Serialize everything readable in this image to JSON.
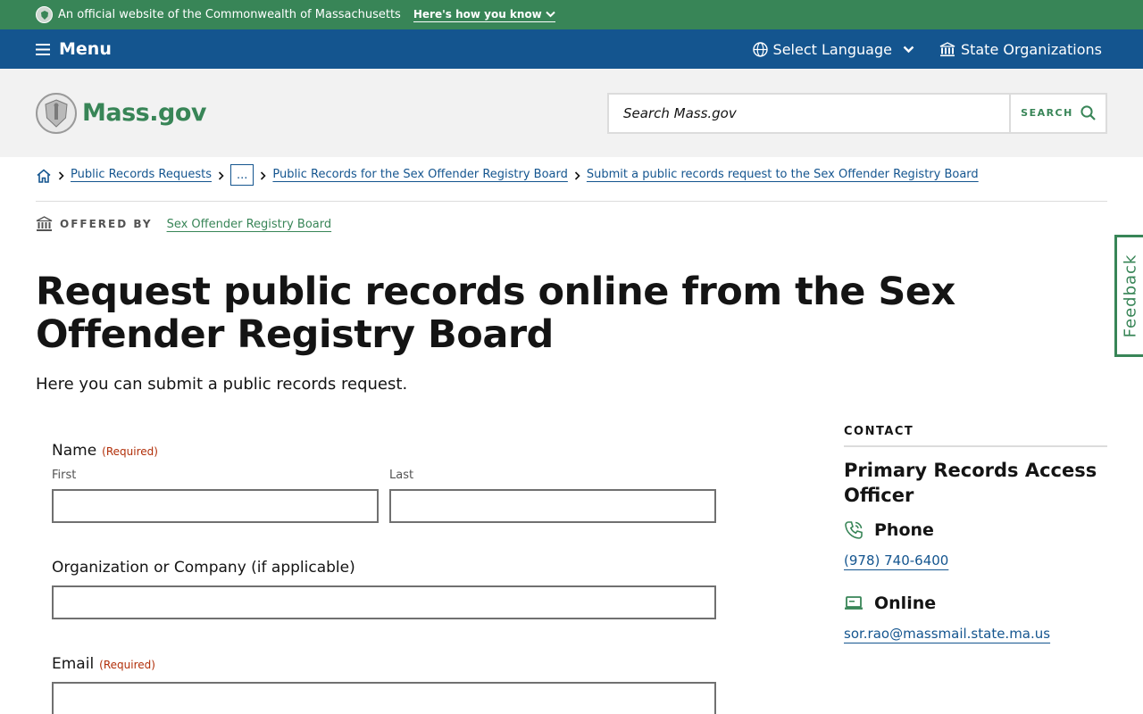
{
  "official_banner": {
    "text": "An official website of the Commonwealth of Massachusetts",
    "how_you_know": "Here's how you know"
  },
  "utility_nav": {
    "menu_label": "Menu",
    "language_label": "Select Language",
    "state_orgs_label": "State Organizations"
  },
  "header": {
    "logo_text": "Mass.gov",
    "search_placeholder": "Search Mass.gov",
    "search_button": "SEARCH"
  },
  "breadcrumb": {
    "items": [
      "Public Records Requests",
      "...",
      "Public Records for the Sex Offender Registry Board",
      "Submit a public records request to the Sex Offender Registry Board"
    ]
  },
  "offered_by": {
    "label": "OFFERED BY",
    "org": "Sex Offender Registry Board"
  },
  "page": {
    "title": "Request public records online from the Sex Offender Registry Board",
    "lede": "Here you can submit a public records request."
  },
  "feedback": {
    "label": "Feedback"
  },
  "form": {
    "name_label": "Name",
    "required_text": "(Required)",
    "first_label": "First",
    "last_label": "Last",
    "org_label": "Organization or Company (if applicable)",
    "email_label": "Email"
  },
  "contact": {
    "heading": "CONTACT",
    "name": "Primary Records Access Officer",
    "phone_label": "Phone",
    "phone_value": "(978) 740-6400",
    "online_label": "Online",
    "email_value": "sor.rao@massmail.state.ma.us"
  },
  "colors": {
    "brand_green": "#388557",
    "nav_blue": "#14558f",
    "required_red": "#b12e08"
  }
}
